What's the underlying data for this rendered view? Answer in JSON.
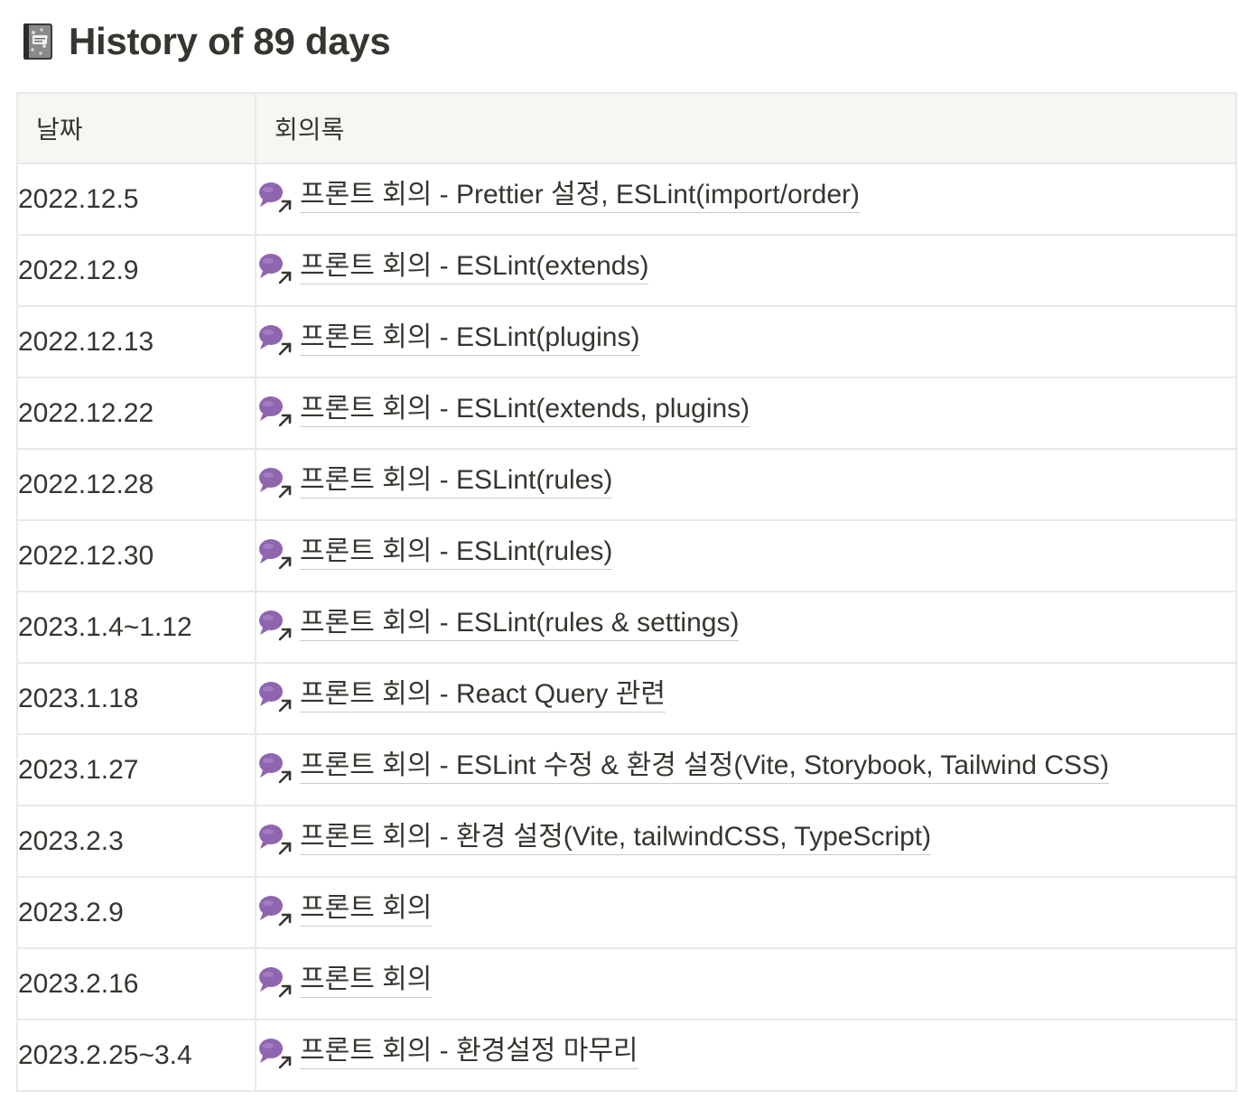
{
  "page": {
    "title": "History of 89 days",
    "title_icon": "notebook-icon"
  },
  "table": {
    "columns": [
      "날짜",
      "회의록"
    ],
    "rows": [
      {
        "date": "2022.12.5",
        "link": "프론트 회의 - Prettier 설정, ESLint(import/order)"
      },
      {
        "date": "2022.12.9",
        "link": "프론트 회의 - ESLint(extends)"
      },
      {
        "date": "2022.12.13",
        "link": "프론트 회의 - ESLint(plugins)"
      },
      {
        "date": "2022.12.22",
        "link": "프론트 회의 - ESLint(extends, plugins)"
      },
      {
        "date": "2022.12.28",
        "link": "프론트 회의 - ESLint(rules)"
      },
      {
        "date": "2022.12.30",
        "link": "프론트 회의 - ESLint(rules)"
      },
      {
        "date": "2023.1.4~1.12",
        "link": "프론트 회의 - ESLint(rules & settings)"
      },
      {
        "date": "2023.1.18",
        "link": "프론트 회의 - React Query 관련"
      },
      {
        "date": "2023.1.27",
        "link": "프론트 회의 - ESLint 수정 & 환경 설정(Vite, Storybook, Tailwind CSS)"
      },
      {
        "date": "2023.2.3",
        "link": "프론트 회의 - 환경 설정(Vite, tailwindCSS, TypeScript)"
      },
      {
        "date": "2023.2.9",
        "link": "프론트 회의"
      },
      {
        "date": "2023.2.16",
        "link": "프론트 회의"
      },
      {
        "date": "2023.2.25~3.4",
        "link": "프론트 회의 - 환경설정 마무리"
      }
    ],
    "link_icon": "speech-bubble-link-icon"
  },
  "colors": {
    "text": "#37352f",
    "border": "#e9e9e7",
    "header_bg": "#f7f6f3",
    "bubble": "#9065b0"
  }
}
